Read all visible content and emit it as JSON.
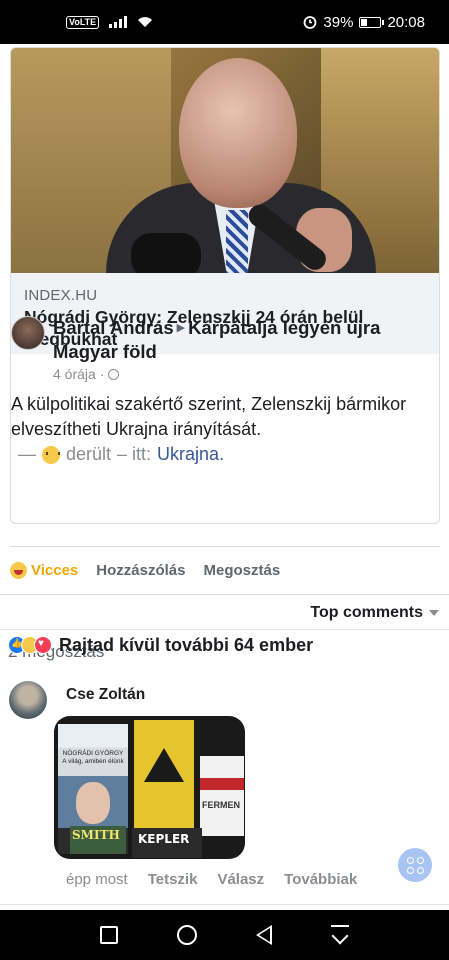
{
  "status_bar": {
    "network_badge": "VoLTE",
    "alarm_icon": "alarm-icon",
    "battery_percent": "39%",
    "battery_level": 0.39,
    "time": "20:08"
  },
  "link_preview": {
    "domain": "INDEX.HU",
    "title": "Nógrádi György: Zelenszkij 24 órán belül megbukhat"
  },
  "post": {
    "author": "Bartal András",
    "group": "Kárpátalja legyen újra Magyar föld",
    "time": "4 órája",
    "separator": "·",
    "text": "A külpolitikai szakértő szerint, Zelenszkij bármikor elveszítheti Ukrajna irányítását.",
    "feeling_dash": "—",
    "feeling": "derült",
    "location_prefix": "– itt:",
    "location": "Ukrajna."
  },
  "actions": {
    "reaction": "Vicces",
    "comment": "Hozzászólás",
    "share": "Megosztás"
  },
  "comments_header": {
    "sort": "Top comments"
  },
  "reactions_summary": {
    "text": "Rajtad kívül további 64 ember",
    "shares_text": "2 megosztás"
  },
  "comment": {
    "author": "Cse Zoltán",
    "photo_texts": {
      "book1": "NÓGRÁDI GYÖRGY A világ, amiben élünk",
      "book3": "FERMEN",
      "book4": "KEPLER",
      "book5": "SMITH"
    },
    "time": "épp most",
    "like": "Tetszik",
    "reply": "Válasz",
    "more": "Továbbiak"
  },
  "colors": {
    "facebook_blue": "#1877f2",
    "haha_yellow": "#f0a800",
    "link_blue": "#385898"
  }
}
